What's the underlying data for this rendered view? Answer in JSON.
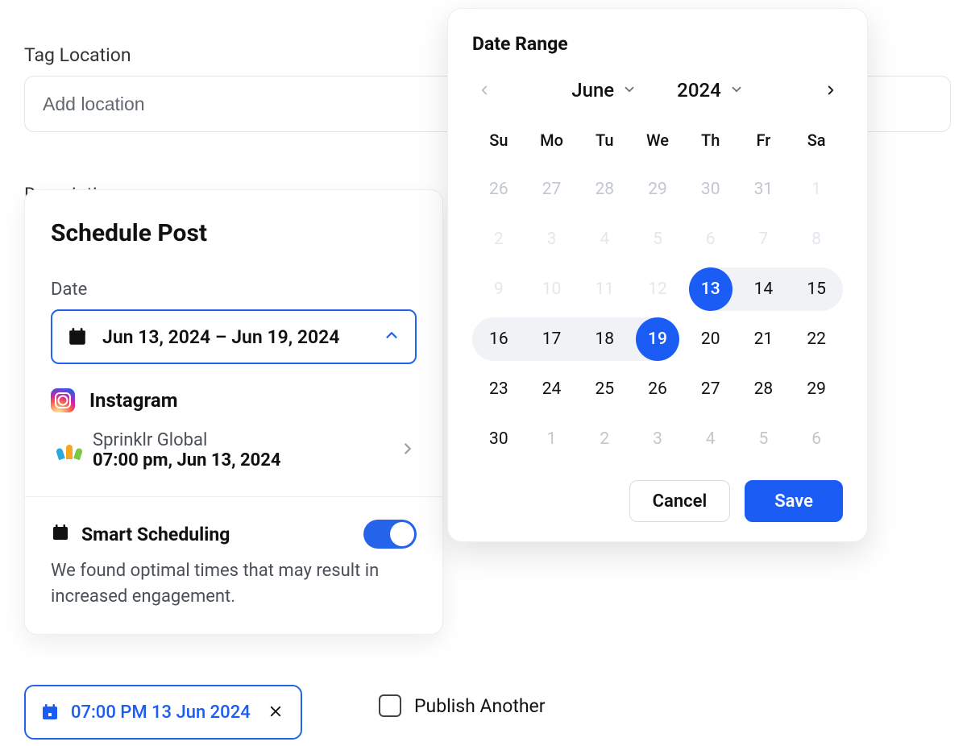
{
  "page": {
    "tag_location_label": "Tag Location",
    "location_placeholder": "Add location",
    "description_label": "Description"
  },
  "schedule": {
    "title": "Schedule Post",
    "date_label": "Date",
    "date_range_text": "Jun 13, 2024 – Jun 19, 2024",
    "platform": "Instagram",
    "account_name": "Sprinklr Global",
    "account_time": "07:00 pm, Jun 13, 2024",
    "smart_title": "Smart Scheduling",
    "smart_desc": "We found optimal times that may result in increased engagement.",
    "smart_enabled": true
  },
  "calendar": {
    "title": "Date Range",
    "month": "June",
    "year": "2024",
    "dow": [
      "Su",
      "Mo",
      "Tu",
      "We",
      "Th",
      "Fr",
      "Sa"
    ],
    "weeks": [
      [
        {
          "d": "26",
          "muted": true
        },
        {
          "d": "27",
          "muted": true
        },
        {
          "d": "28",
          "muted": true
        },
        {
          "d": "29",
          "muted": true
        },
        {
          "d": "30",
          "muted": true
        },
        {
          "d": "31",
          "muted": true
        },
        {
          "d": "1",
          "faded": true
        }
      ],
      [
        {
          "d": "2",
          "faded": true
        },
        {
          "d": "3",
          "faded": true
        },
        {
          "d": "4",
          "faded": true
        },
        {
          "d": "5",
          "faded": true
        },
        {
          "d": "6",
          "faded": true
        },
        {
          "d": "7",
          "faded": true
        },
        {
          "d": "8",
          "faded": true
        }
      ],
      [
        {
          "d": "9",
          "faded": true
        },
        {
          "d": "10",
          "faded": true
        },
        {
          "d": "11",
          "faded": true
        },
        {
          "d": "12",
          "faded": true
        },
        {
          "d": "13",
          "sel": true,
          "range": "start"
        },
        {
          "d": "14",
          "range": "mid"
        },
        {
          "d": "15",
          "range": "row-end"
        }
      ],
      [
        {
          "d": "16",
          "range": "row-start"
        },
        {
          "d": "17",
          "range": "mid"
        },
        {
          "d": "18",
          "range": "mid"
        },
        {
          "d": "19",
          "sel": true,
          "range": "end"
        },
        {
          "d": "20"
        },
        {
          "d": "21"
        },
        {
          "d": "22"
        }
      ],
      [
        {
          "d": "23"
        },
        {
          "d": "24"
        },
        {
          "d": "25"
        },
        {
          "d": "26"
        },
        {
          "d": "27"
        },
        {
          "d": "28"
        },
        {
          "d": "29"
        }
      ],
      [
        {
          "d": "30"
        },
        {
          "d": "1",
          "muted": true
        },
        {
          "d": "2",
          "muted": true
        },
        {
          "d": "3",
          "muted": true
        },
        {
          "d": "4",
          "muted": true
        },
        {
          "d": "5",
          "muted": true
        },
        {
          "d": "6",
          "muted": true
        }
      ]
    ],
    "cancel_label": "Cancel",
    "save_label": "Save"
  },
  "bottom": {
    "chip_text": "07:00 PM 13 Jun 2024",
    "publish_another": "Publish Another"
  }
}
